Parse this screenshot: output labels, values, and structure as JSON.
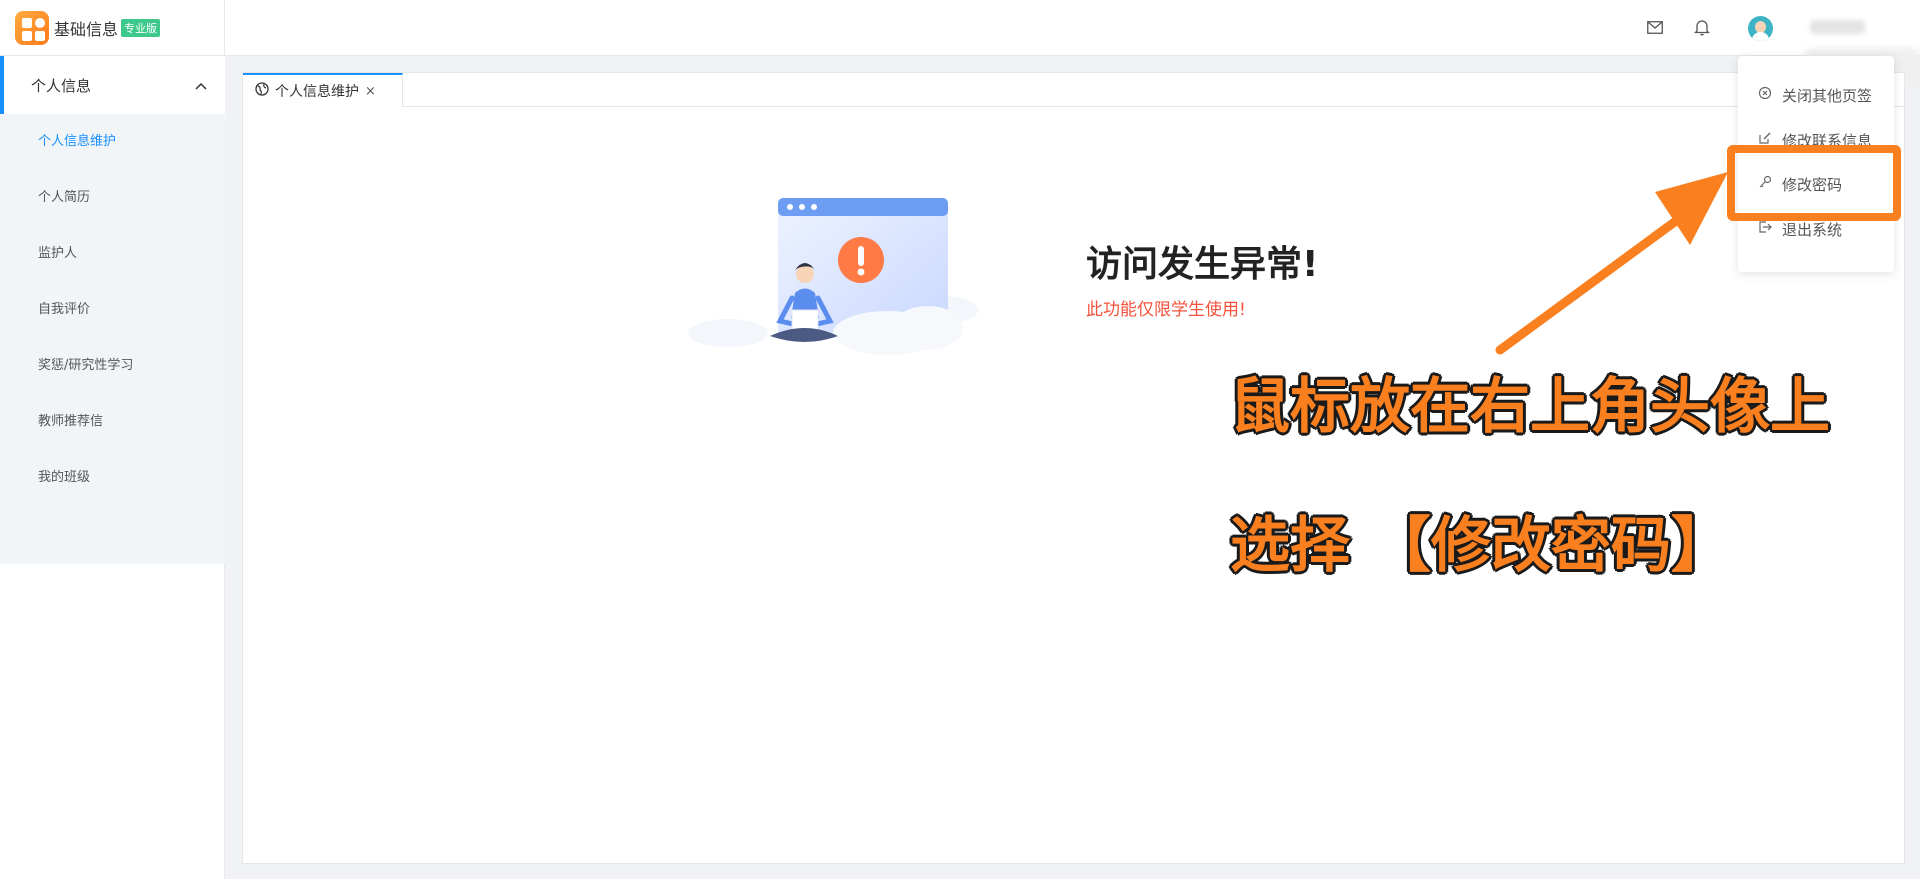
{
  "header": {
    "app_title": "基础信息",
    "edition_badge": "专业版",
    "icons": [
      "grid-logo-icon",
      "mail-icon",
      "bell-icon",
      "avatar-icon"
    ]
  },
  "sidebar": {
    "group_label": "个人信息",
    "items": [
      {
        "label": "个人信息维护",
        "active": true
      },
      {
        "label": "个人简历",
        "active": false
      },
      {
        "label": "监护人",
        "active": false
      },
      {
        "label": "自我评价",
        "active": false
      },
      {
        "label": "奖惩/研究性学习",
        "active": false
      },
      {
        "label": "教师推荐信",
        "active": false
      },
      {
        "label": "我的班级",
        "active": false
      }
    ]
  },
  "tabs": [
    {
      "label": "个人信息维护",
      "close": "×",
      "icon": "globe-icon"
    }
  ],
  "main": {
    "error_title": "访问发生异常!",
    "error_message": "此功能仅限学生使用!"
  },
  "dropdown": {
    "items": [
      {
        "label": "关闭其他页签",
        "icon": "close-circle-icon"
      },
      {
        "label": "修改联系信息",
        "icon": "edit-icon"
      },
      {
        "label": "修改密码",
        "icon": "key-icon"
      },
      {
        "label": "退出系统",
        "icon": "logout-icon"
      }
    ]
  },
  "annotation": {
    "line1": "鼠标放在右上角头像上",
    "line2": "选择 【修改密码】"
  },
  "colors": {
    "accent": "#1890ff",
    "annotation": "#f97f1f",
    "error_text": "#f5533d",
    "badge": "#3cc88b"
  }
}
